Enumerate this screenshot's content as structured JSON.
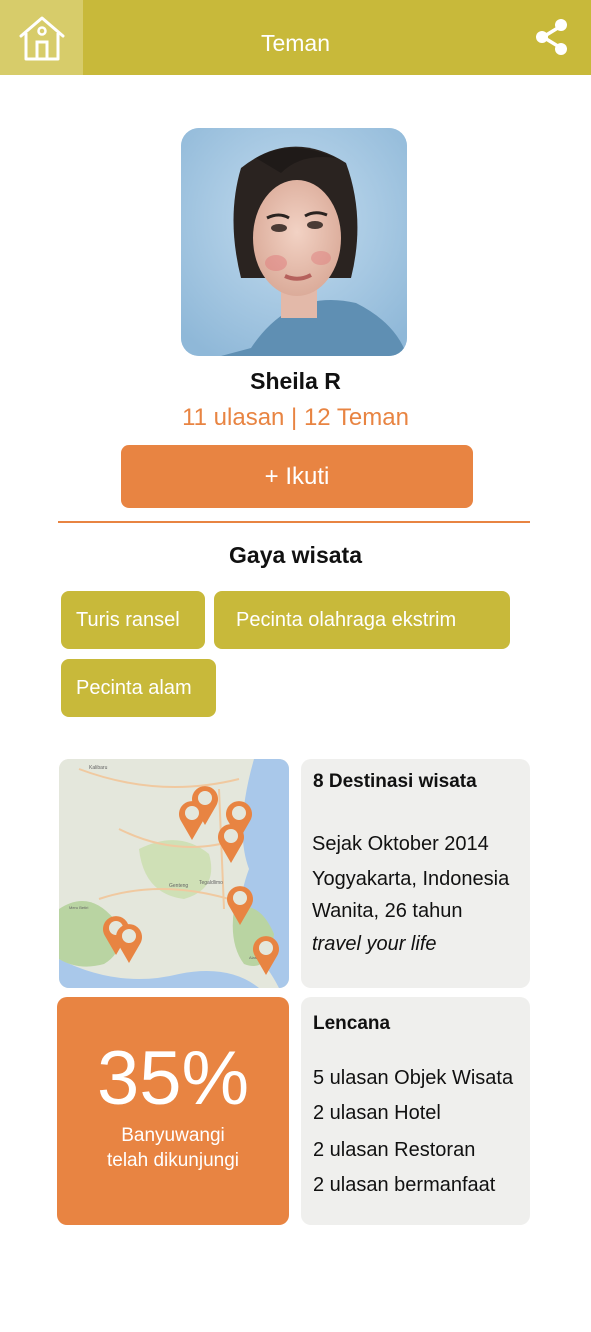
{
  "header": {
    "title": "Teman",
    "home_icon": "home-icon",
    "share_icon": "share-icon"
  },
  "profile": {
    "name": "Sheila R",
    "stats": "11 ulasan | 12 Teman",
    "follow_label": "+ Ikuti"
  },
  "travel_style": {
    "title": "Gaya wisata",
    "tags": [
      "Turis ransel",
      "Pecinta olahraga ekstrim",
      "Pecinta alam"
    ]
  },
  "map": {
    "labels": [
      "Kalibaru",
      "Genteng",
      "Rogojampi",
      "Banyuwangi",
      "Tegaldlimo",
      "Taman Nasional Alas Purwo",
      "Taman Nasional Meru Betiri"
    ]
  },
  "info": {
    "destinations": "8 Destinasi wisata",
    "since": "Sejak Oktober 2014",
    "location": "Yogyakarta, Indonesia",
    "gender_age": "Wanita, 26 tahun",
    "motto": "travel your life"
  },
  "progress": {
    "value": "35%",
    "line1": "Banyuwangi",
    "line2": "telah dikunjungi"
  },
  "badges": {
    "title": "Lencana",
    "items": [
      "5 ulasan Objek Wisata",
      "2 ulasan Hotel",
      "2 ulasan Restoran",
      "2 ulasan bermanfaat"
    ]
  },
  "colors": {
    "olive": "#c8b93a",
    "orange": "#e88442",
    "card_gray": "#efefed"
  }
}
